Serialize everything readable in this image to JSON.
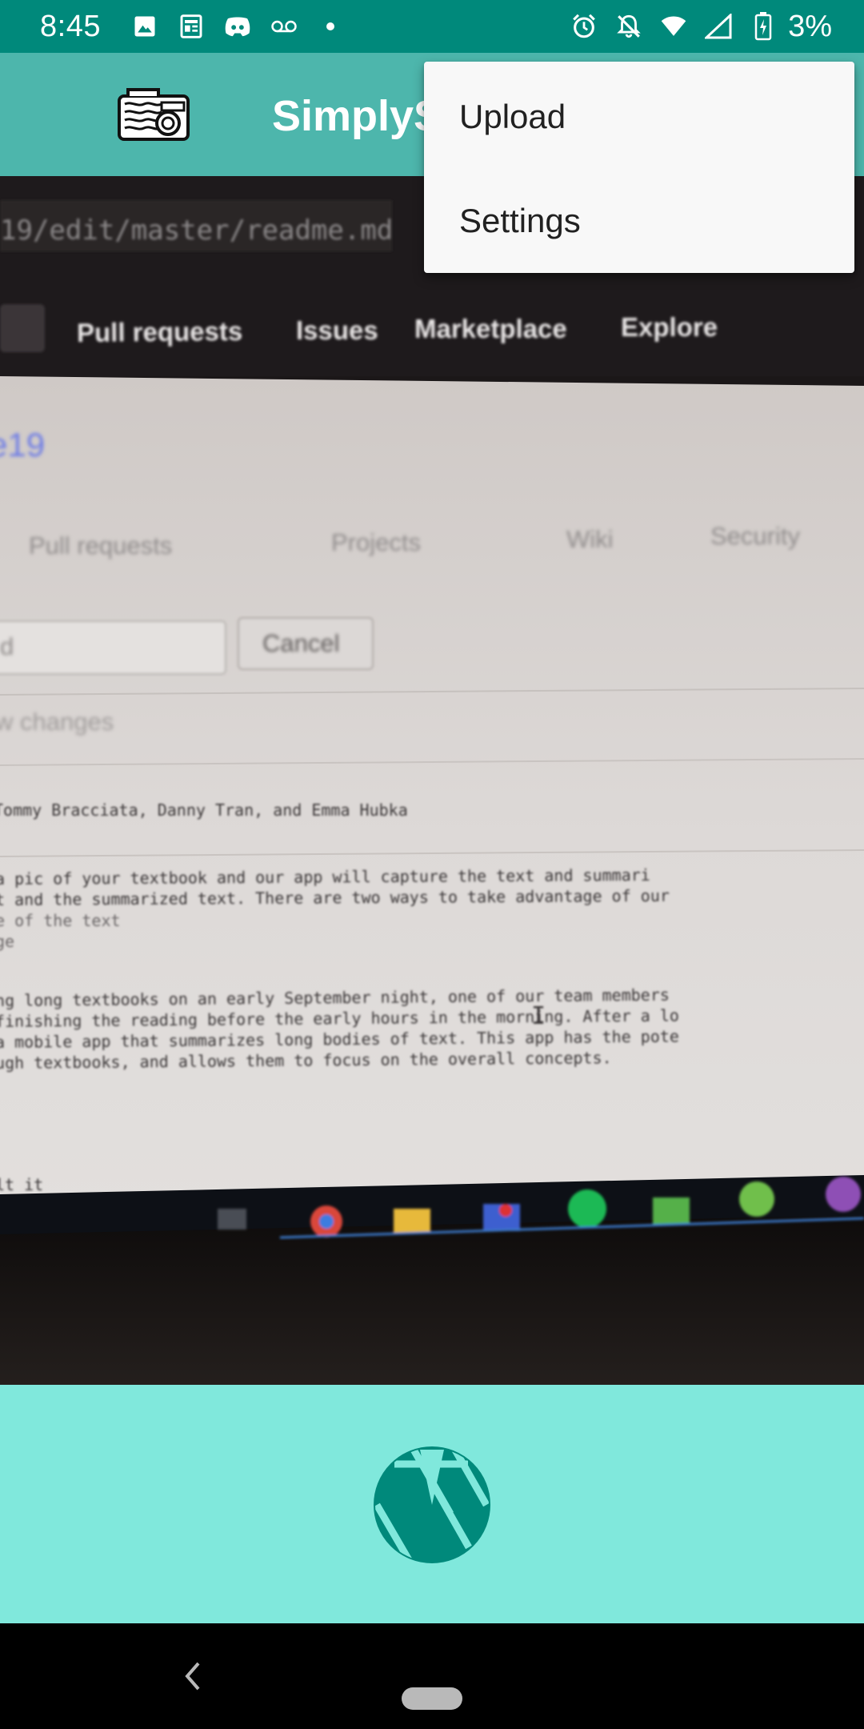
{
  "status_bar": {
    "time": "8:45",
    "left_icons": [
      "image-icon",
      "news-icon",
      "discord-icon",
      "voicemail-icon",
      "dot-icon"
    ],
    "right_icons": [
      "alarm-icon",
      "notifications-off-icon",
      "wifi-icon",
      "cell-signal-icon",
      "battery-charging-icon"
    ],
    "battery": "3%"
  },
  "app_bar": {
    "title": "SimplyS",
    "logo_icon": "document-camera-logo-icon",
    "color": "#4db6ac"
  },
  "camera_preview": {
    "text_lines": [
      "19/edit/master/readme.md",
      "Pull requests",
      "Issues",
      "Marketplace",
      "Explore",
      "e19",
      "Pull requests",
      "Projects",
      "Wiki",
      "Security",
      "d",
      "Cancel",
      "w changes",
      "Tommy Bracciata, Danny Tran, and Emma Hubka",
      "a pic of your textbook and our app will capture the text and summari",
      "t and the summarized text. There are two ways to take advantage of our",
      "e of the text",
      "ge",
      "ng long textbooks on an early September night, one of our team members",
      "finishing the reading before the early hours in the morning. After a lo",
      "a mobile app that summarizes long bodies of text. This app has the pote",
      "ugh textbooks, and allows them to focus on the overall concepts.",
      "lt it"
    ]
  },
  "bottom_panel": {
    "color": "#80e8dc",
    "shutter_icon": "camera-shutter-icon",
    "shutter_color": "#00897b"
  },
  "overflow_menu": {
    "items": [
      {
        "label": "Upload"
      },
      {
        "label": "Settings"
      }
    ]
  },
  "nav_bar": {
    "back_icon": "back-chevron-icon",
    "home_icon": "home-pill-icon"
  }
}
